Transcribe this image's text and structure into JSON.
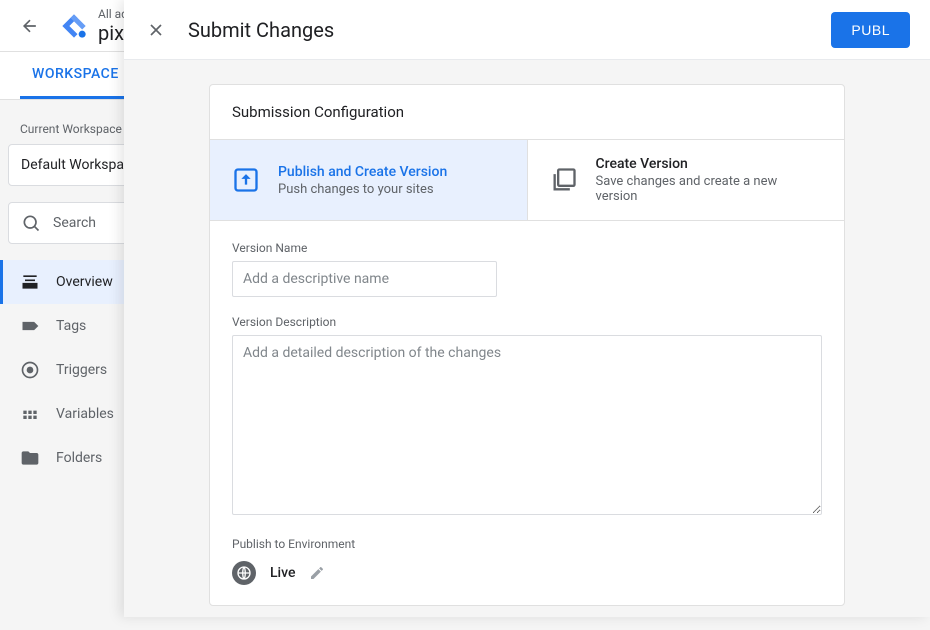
{
  "header": {
    "breadcrumb_top": "All ad",
    "container_name": "pix"
  },
  "tabs": {
    "workspace": "WORKSPACE"
  },
  "sidebar": {
    "current_workspace_label": "Current Workspace",
    "workspace_name": "Default Workspace",
    "search_placeholder": "Search",
    "nav": {
      "overview": "Overview",
      "tags": "Tags",
      "triggers": "Triggers",
      "variables": "Variables",
      "folders": "Folders"
    }
  },
  "modal": {
    "title": "Submit Changes",
    "publish_button": "PUBL",
    "card_title": "Submission Configuration",
    "options": {
      "publish": {
        "title": "Publish and Create Version",
        "subtitle": "Push changes to your sites"
      },
      "create": {
        "title": "Create Version",
        "subtitle": "Save changes and create a new version"
      }
    },
    "version_name_label": "Version Name",
    "version_name_placeholder": "Add a descriptive name",
    "version_desc_label": "Version Description",
    "version_desc_placeholder": "Add a detailed description of the changes",
    "environment_label": "Publish to Environment",
    "environment_name": "Live"
  }
}
